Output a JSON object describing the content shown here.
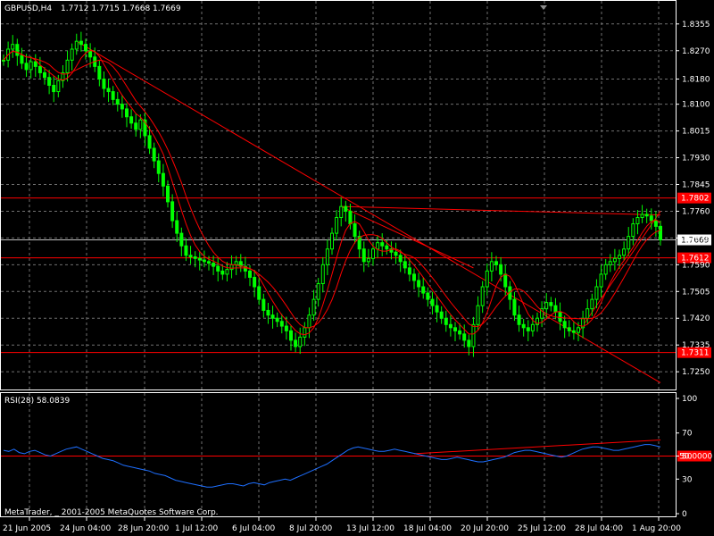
{
  "main_header": {
    "symbol": "GBPUSD,H4",
    "ohlc": "1.7712 1.7715 1.7668 1.7669"
  },
  "rsi_header": {
    "label": "RSI(28) 58.0839"
  },
  "copyright": "MetaTrader, _ 2001-2005 MetaQuotes Software Corp.",
  "colors": {
    "background": "#000000",
    "grid": "#707070",
    "bull_candle": "#00ff00",
    "frame": "#ffffff",
    "lines": "#ff0000",
    "rsi_line": "#1e6fff"
  },
  "chart_data": [
    {
      "type": "candlestick",
      "symbol": "GBPUSD",
      "timeframe": "H4",
      "ylim": [
        1.7205,
        1.838
      ],
      "y_ticks": [
        "1.8355",
        "1.8270",
        "1.8180",
        "1.8100",
        "1.8015",
        "1.7930",
        "1.7845",
        "1.7760",
        "1.7675",
        "1.7590",
        "1.7505",
        "1.7420",
        "1.7335",
        "1.7250"
      ],
      "x_ticks": [
        "21 Jun 2005",
        "24 Jun 04:00",
        "28 Jun 20:00",
        "1 Jul 12:00",
        "6 Jul 04:00",
        "8 Jul 20:00",
        "13 Jul 12:00",
        "18 Jul 04:00",
        "20 Jul 20:00",
        "25 Jul 12:00",
        "28 Jul 04:00",
        "1 Aug 20:00"
      ],
      "current_price": "1.7669",
      "horizontal_levels": [
        {
          "price": 1.7802,
          "label": "1.7802"
        },
        {
          "price": 1.7612,
          "label": "1.7612"
        },
        {
          "price": 1.7311,
          "label": "1.7311"
        }
      ],
      "closes": [
        1.824,
        1.8275,
        1.829,
        1.8255,
        1.823,
        1.821,
        1.8235,
        1.822,
        1.82,
        1.8185,
        1.816,
        1.814,
        1.8175,
        1.82,
        1.824,
        1.8275,
        1.83,
        1.829,
        1.827,
        1.825,
        1.822,
        1.818,
        1.815,
        1.814,
        1.8115,
        1.81,
        1.8085,
        1.806,
        1.804,
        1.802,
        1.805,
        1.8,
        1.796,
        1.792,
        1.788,
        1.784,
        1.779,
        1.773,
        1.769,
        1.765,
        1.762,
        1.7615,
        1.761,
        1.7605,
        1.76,
        1.7595,
        1.7585,
        1.757,
        1.756,
        1.7575,
        1.759,
        1.76,
        1.7585,
        1.757,
        1.755,
        1.752,
        1.748,
        1.7445,
        1.743,
        1.742,
        1.741,
        1.7395,
        1.738,
        1.735,
        1.733,
        1.736,
        1.739,
        1.743,
        1.748,
        1.753,
        1.759,
        1.764,
        1.769,
        1.774,
        1.7775,
        1.776,
        1.772,
        1.768,
        1.764,
        1.76,
        1.761,
        1.764,
        1.766,
        1.765,
        1.764,
        1.763,
        1.762,
        1.76,
        1.758,
        1.756,
        1.754,
        1.752,
        1.75,
        1.748,
        1.746,
        1.744,
        1.742,
        1.74,
        1.739,
        1.738,
        1.737,
        1.735,
        1.733,
        1.74,
        1.746,
        1.752,
        1.757,
        1.76,
        1.759,
        1.756,
        1.752,
        1.748,
        1.743,
        1.74,
        1.739,
        1.738,
        1.74,
        1.742,
        1.745,
        1.747,
        1.746,
        1.744,
        1.741,
        1.739,
        1.738,
        1.7375,
        1.739,
        1.742,
        1.745,
        1.748,
        1.752,
        1.756,
        1.759,
        1.76,
        1.761,
        1.762,
        1.764,
        1.768,
        1.772,
        1.774,
        1.775,
        1.7745,
        1.773,
        1.7712,
        1.7669
      ],
      "rsi": {
        "period": 28,
        "value": 58.0839,
        "ylim": [
          0,
          100
        ],
        "levels": [
          50
        ],
        "level_label": "50.0000",
        "y_ticks": [
          "100",
          "70",
          "50",
          "30",
          "0"
        ],
        "values": [
          55,
          54,
          56,
          53,
          52,
          54,
          55,
          53,
          51,
          50,
          52,
          54,
          56,
          57,
          58,
          56,
          54,
          52,
          50,
          48,
          47,
          46,
          44,
          42,
          41,
          40,
          39,
          38,
          37,
          35,
          34,
          33,
          31,
          29,
          28,
          27,
          26,
          25,
          24,
          23,
          23,
          24,
          25,
          26,
          26,
          25,
          24,
          26,
          27,
          26,
          25,
          27,
          28,
          29,
          30,
          29,
          31,
          33,
          35,
          37,
          39,
          41,
          43,
          46,
          49,
          52,
          55,
          57,
          58,
          57,
          56,
          55,
          54,
          54,
          55,
          56,
          55,
          54,
          53,
          52,
          51,
          50,
          49,
          48,
          47,
          47,
          48,
          49,
          48,
          47,
          46,
          45,
          45,
          46,
          47,
          48,
          49,
          51,
          53,
          54,
          55,
          55,
          54,
          53,
          52,
          51,
          50,
          49,
          50,
          52,
          54,
          56,
          57,
          58,
          58,
          57,
          56,
          55,
          55,
          56,
          57,
          58,
          59,
          60,
          60,
          59,
          58
        ]
      }
    }
  ]
}
